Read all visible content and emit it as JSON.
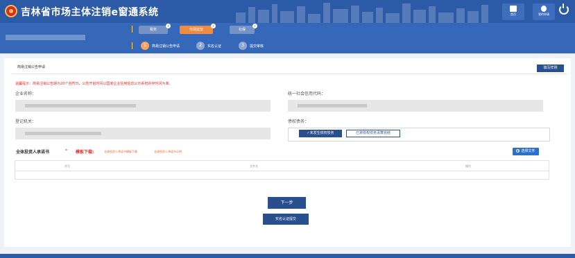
{
  "header": {
    "title": "吉林省市场主体注销e窗通系统",
    "home_label": "首页",
    "user_label": "我的申请",
    "power_icon": "power-icon"
  },
  "tabs": [
    {
      "label": "税务",
      "active": false
    },
    {
      "label": "市场监管",
      "active": true
    },
    {
      "label": "社保",
      "active": false
    }
  ],
  "steps": [
    {
      "num": "1",
      "label": "简易注销公告申请"
    },
    {
      "num": "2",
      "label": "实名认证"
    },
    {
      "num": "3",
      "label": "提交审核"
    }
  ],
  "panel": {
    "title": "简易注销公告申请",
    "fill_button": "填写样例",
    "warning": "温馨提示：简易注销公告期为20个自然日，公告开始时间以国家企业信用信息公示系统并存时间为准。"
  },
  "form": {
    "company_name_label": "企业名称：",
    "credit_code_label": "统一社会信用代码：",
    "authority_label": "登记机关：",
    "debt_label": "债权债务：",
    "debt_option_selected": "✓未发生债权债务",
    "debt_option_other": "已将债权债务清算完结"
  },
  "commitment": {
    "title": "全体投资人承诺书",
    "required_mark": "*",
    "template_label": "模板下载:",
    "link_template": "全体投资人承诺书模板下载",
    "link_example": "全体投资人承诺书示例",
    "choose_button": "选择文件",
    "columns": [
      "序号",
      "文件名",
      "操作"
    ]
  },
  "actions": {
    "next": "下一步",
    "verify_submit": "实名认证提交"
  },
  "colors": {
    "header": "#2d5aa6",
    "accent": "#2a4f8f",
    "active_tab": "#f08a3e",
    "warning": "#e0322b"
  }
}
